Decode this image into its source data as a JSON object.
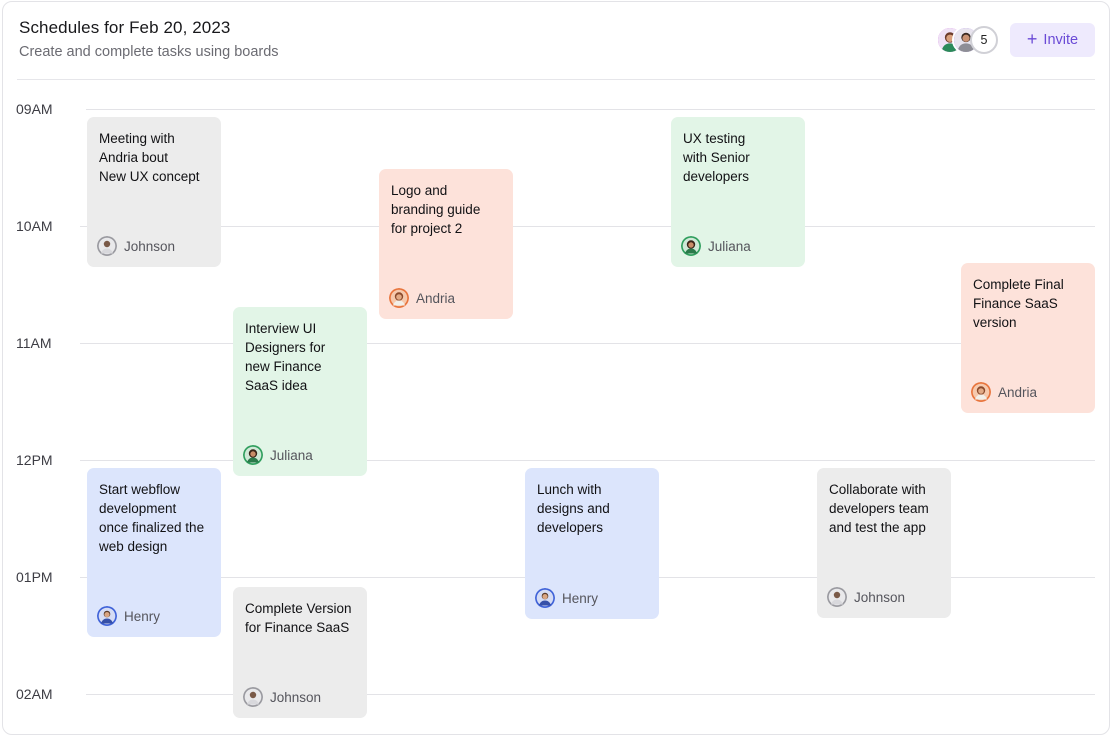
{
  "header": {
    "title": "Schedules for Feb 20, 2023",
    "subtitle": "Create and complete tasks using boards",
    "member_count": "5",
    "invite_label": "Invite"
  },
  "times": [
    "09AM",
    "10AM",
    "11AM",
    "12PM",
    "01PM",
    "02AM"
  ],
  "people": {
    "johnson": {
      "name": "Johnson",
      "ring": "#9a9aa0"
    },
    "andria": {
      "name": "Andria",
      "ring": "#e8743c"
    },
    "juliana": {
      "name": "Juliana",
      "ring": "#2f9e5d"
    },
    "henry": {
      "name": "Henry",
      "ring": "#3f62d8"
    }
  },
  "tasks": [
    {
      "text": "Meeting with\nAndria bout\nNew UX concept",
      "assignee": "Johnson",
      "color": "gray"
    },
    {
      "text": "Logo and\nbranding guide\nfor project 2",
      "assignee": "Andria",
      "color": "peach"
    },
    {
      "text": "UX testing\nwith Senior\ndevelopers",
      "assignee": "Juliana",
      "color": "green"
    },
    {
      "text": "Complete Final\nFinance SaaS\nversion",
      "assignee": "Andria",
      "color": "peach"
    },
    {
      "text": "Interview UI\nDesigners for\nnew Finance\nSaaS idea",
      "assignee": "Juliana",
      "color": "green"
    },
    {
      "text": "Start webflow\ndevelopment\nonce finalized the\nweb design",
      "assignee": "Henry",
      "color": "blue"
    },
    {
      "text": "Lunch with\ndesigns and\ndevelopers",
      "assignee": "Henry",
      "color": "blue"
    },
    {
      "text": "Collaborate with\ndevelopers team\nand test the app",
      "assignee": "Johnson",
      "color": "gray"
    },
    {
      "text": "Complete Version\nfor Finance SaaS",
      "assignee": "Johnson",
      "color": "gray"
    }
  ]
}
